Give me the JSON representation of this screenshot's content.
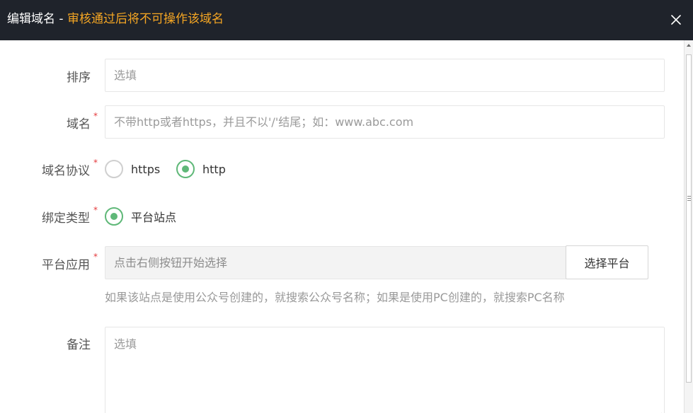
{
  "dialog": {
    "title": "编辑域名 - ",
    "title_warning": "审核通过后将不可操作该域名"
  },
  "form": {
    "sort": {
      "label": "排序",
      "placeholder": "选填"
    },
    "domain": {
      "label": "域名",
      "required_mark": "*",
      "placeholder": "不带http或者https，并且不以'/'结尾；如：www.abc.com"
    },
    "protocol": {
      "label": "域名协议",
      "required_mark": "*",
      "options": [
        {
          "label": "https",
          "checked": false
        },
        {
          "label": "http",
          "checked": true
        }
      ]
    },
    "bind_type": {
      "label": "绑定类型",
      "required_mark": "*",
      "options": [
        {
          "label": "平台站点",
          "checked": true
        }
      ]
    },
    "platform": {
      "label": "平台应用",
      "required_mark": "*",
      "placeholder": "点击右侧按钮开始选择",
      "button_label": "选择平台",
      "hint": "如果该站点是使用公众号创建的，就搜索公众号名称；如果是使用PC创建的，就搜索PC名称"
    },
    "remark": {
      "label": "备注",
      "placeholder": "选填"
    }
  },
  "colors": {
    "titlebar_bg": "#1f232b",
    "title_warning": "#f5a623",
    "radio_checked": "#5fb878",
    "required_mark": "#e4393c"
  }
}
